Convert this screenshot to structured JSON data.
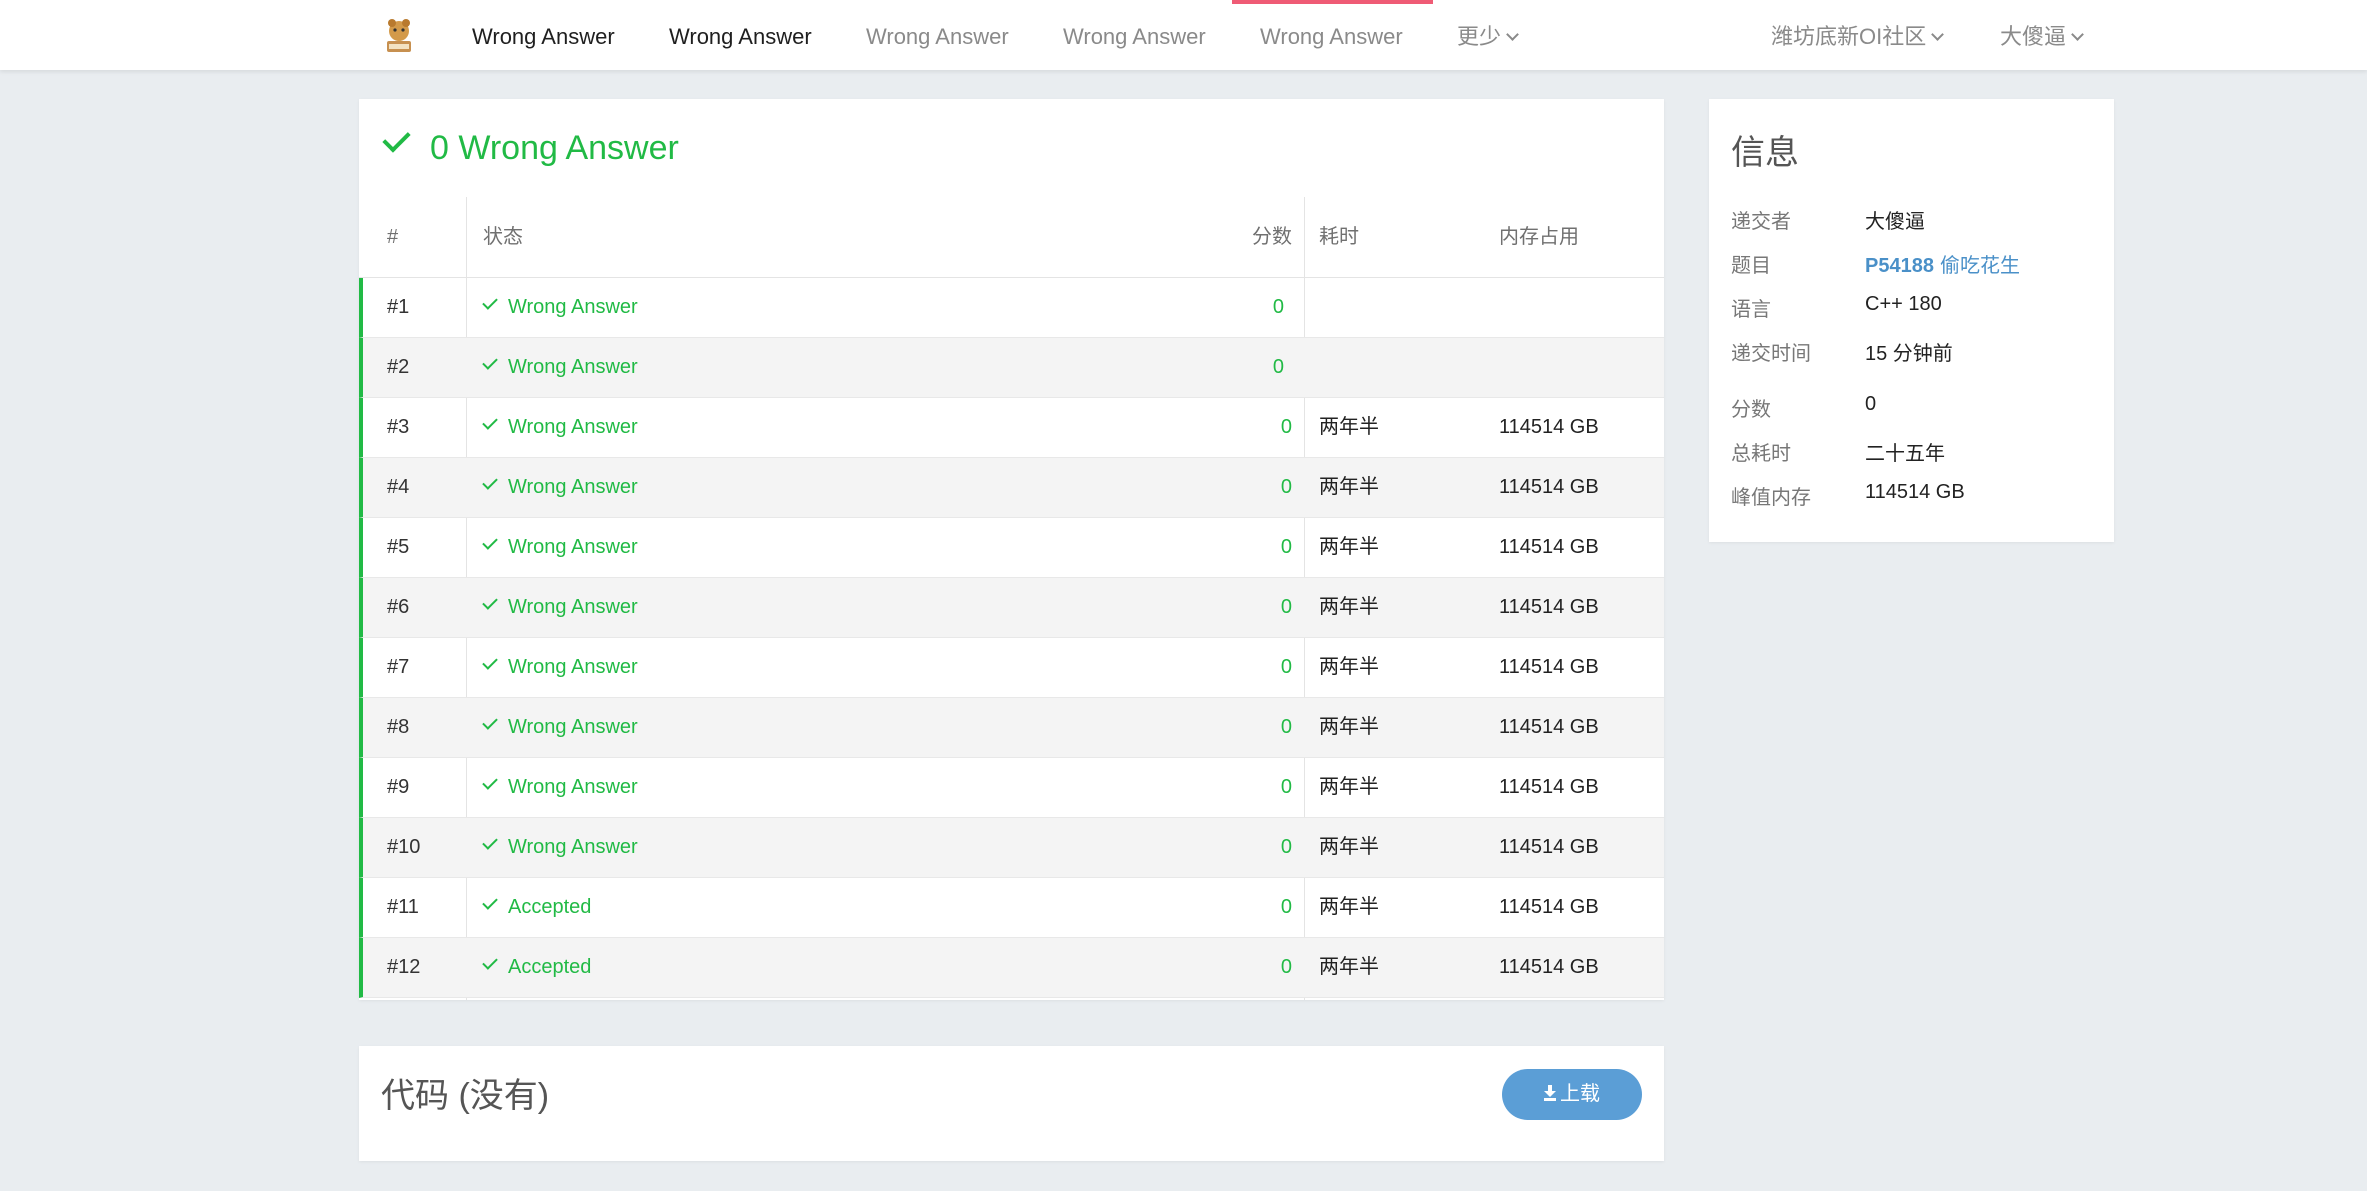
{
  "nav": {
    "items": [
      {
        "label": "Wrong Answer",
        "style": "dark"
      },
      {
        "label": "Wrong Answer",
        "style": "dark"
      },
      {
        "label": "Wrong Answer",
        "style": "muted"
      },
      {
        "label": "Wrong Answer",
        "style": "muted"
      },
      {
        "label": "Wrong Answer",
        "style": "muted",
        "active": true
      }
    ],
    "more_label": "更少",
    "community_label": "潍坊底新OI社区",
    "user_label": "大傻逼",
    "active_color": "#ef5b75"
  },
  "result": {
    "title": "0 Wrong Answer",
    "columns": {
      "index": "#",
      "status": "状态",
      "score": "分数",
      "time": "耗时",
      "memory": "内存占用"
    },
    "rows": [
      {
        "index": "#1",
        "status": "Wrong Answer",
        "score": "0",
        "time": "",
        "memory": ""
      },
      {
        "index": "#2",
        "status": "Wrong Answer",
        "score": "0",
        "time": "",
        "memory": ""
      },
      {
        "index": "#3",
        "status": "Wrong Answer",
        "score": "0",
        "time": "两年半",
        "memory": "114514 GB"
      },
      {
        "index": "#4",
        "status": "Wrong Answer",
        "score": "0",
        "time": "两年半",
        "memory": "114514 GB"
      },
      {
        "index": "#5",
        "status": "Wrong Answer",
        "score": "0",
        "time": "两年半",
        "memory": "114514 GB"
      },
      {
        "index": "#6",
        "status": "Wrong Answer",
        "score": "0",
        "time": "两年半",
        "memory": "114514 GB"
      },
      {
        "index": "#7",
        "status": "Wrong Answer",
        "score": "0",
        "time": "两年半",
        "memory": "114514 GB"
      },
      {
        "index": "#8",
        "status": "Wrong Answer",
        "score": "0",
        "time": "两年半",
        "memory": "114514 GB"
      },
      {
        "index": "#9",
        "status": "Wrong Answer",
        "score": "0",
        "time": "两年半",
        "memory": "114514 GB"
      },
      {
        "index": "#10",
        "status": "Wrong Answer",
        "score": "0",
        "time": "两年半",
        "memory": "114514 GB"
      },
      {
        "index": "#11",
        "status": "Accepted",
        "score": "0",
        "time": "两年半",
        "memory": "114514 GB"
      },
      {
        "index": "#12",
        "status": "Accepted",
        "score": "0",
        "time": "两年半",
        "memory": "114514 GB"
      }
    ],
    "status_color": "#21ba45"
  },
  "code": {
    "title": "代码 (没有)",
    "upload_label": "上载",
    "upload_icon": "download-icon",
    "button_color": "#5b9ed6"
  },
  "info": {
    "title": "信息",
    "submitter_key": "递交者",
    "submitter": "大傻逼",
    "problem_key": "题目",
    "problem_id": "P54188",
    "problem_name": "偷吃花生",
    "language_key": "语言",
    "language": "C++ 180",
    "submit_time_key": "递交时间",
    "submit_time": "15 分钟前",
    "score_key": "分数",
    "score": "0",
    "total_time_key": "总耗时",
    "total_time": "二十五年",
    "peak_memory_key": "峰值内存",
    "peak_memory": "114514 GB"
  }
}
